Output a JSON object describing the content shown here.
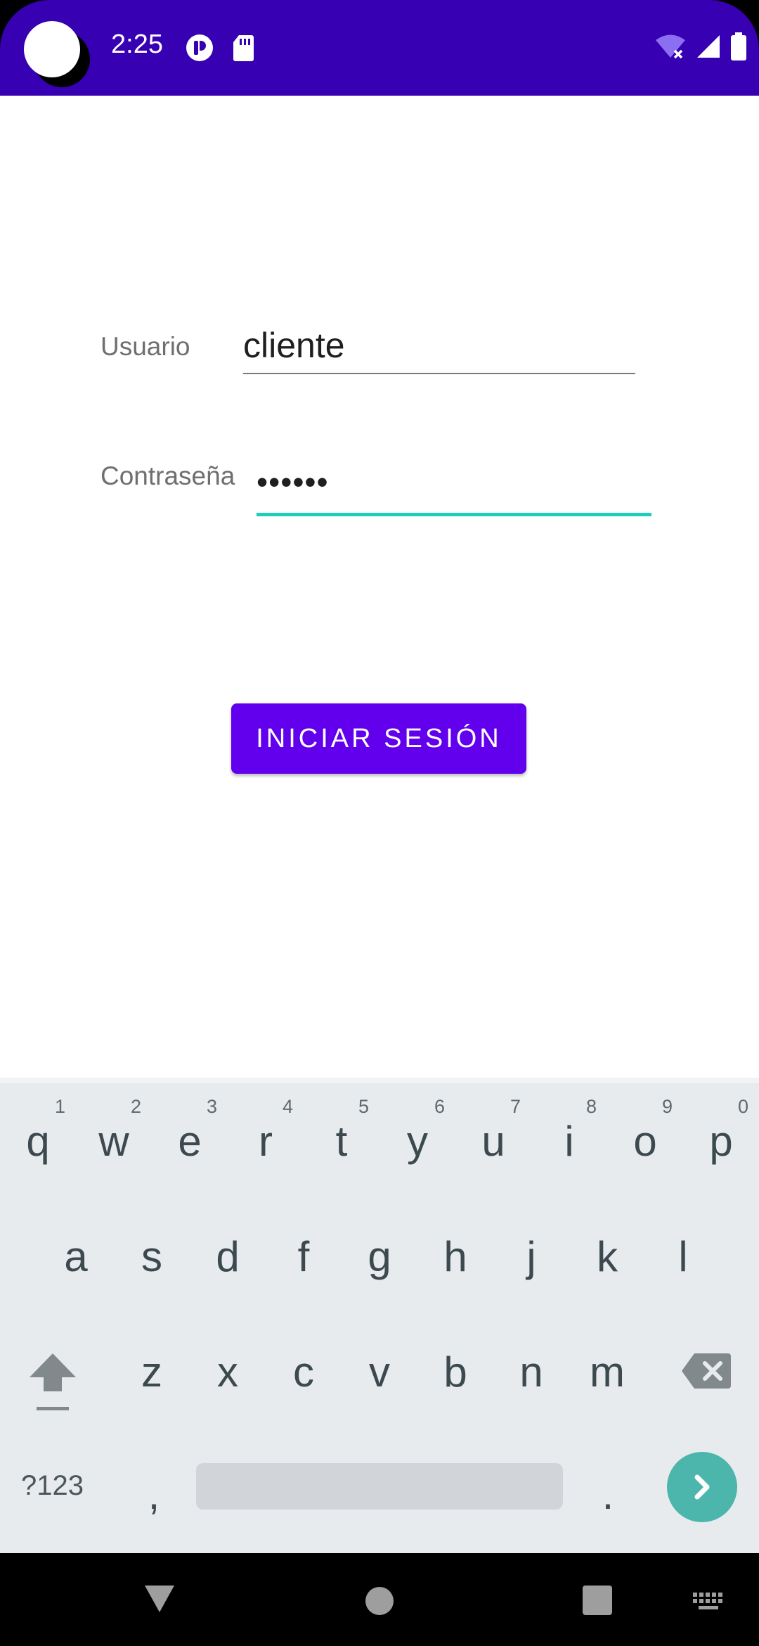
{
  "status_bar": {
    "time": "2:25",
    "icons": [
      "notification-icon",
      "sd-card-icon",
      "wifi-off-icon",
      "signal-icon",
      "battery-icon"
    ],
    "color": "#3700b3"
  },
  "login": {
    "username_label": "Usuario",
    "username_value": "cliente",
    "password_label": "Contraseña",
    "password_value": "••••••",
    "submit_label": "INICIAR SESIÓN",
    "accent_color": "#6200ee",
    "focus_color": "#1ccfbc"
  },
  "keyboard": {
    "row1": [
      {
        "key": "q",
        "hint": "1"
      },
      {
        "key": "w",
        "hint": "2"
      },
      {
        "key": "e",
        "hint": "3"
      },
      {
        "key": "r",
        "hint": "4"
      },
      {
        "key": "t",
        "hint": "5"
      },
      {
        "key": "y",
        "hint": "6"
      },
      {
        "key": "u",
        "hint": "7"
      },
      {
        "key": "i",
        "hint": "8"
      },
      {
        "key": "o",
        "hint": "9"
      },
      {
        "key": "p",
        "hint": "0"
      }
    ],
    "row2": [
      "a",
      "s",
      "d",
      "f",
      "g",
      "h",
      "j",
      "k",
      "l"
    ],
    "row3": [
      "z",
      "x",
      "c",
      "v",
      "b",
      "n",
      "m"
    ],
    "symbols_label": "?123",
    "comma": ",",
    "period": ".",
    "icons": [
      "shift-icon",
      "backspace-icon",
      "enter-arrow-icon"
    ]
  },
  "nav_bar": {
    "icons": [
      "back-icon",
      "home-icon",
      "recents-icon",
      "keyboard-icon"
    ]
  }
}
